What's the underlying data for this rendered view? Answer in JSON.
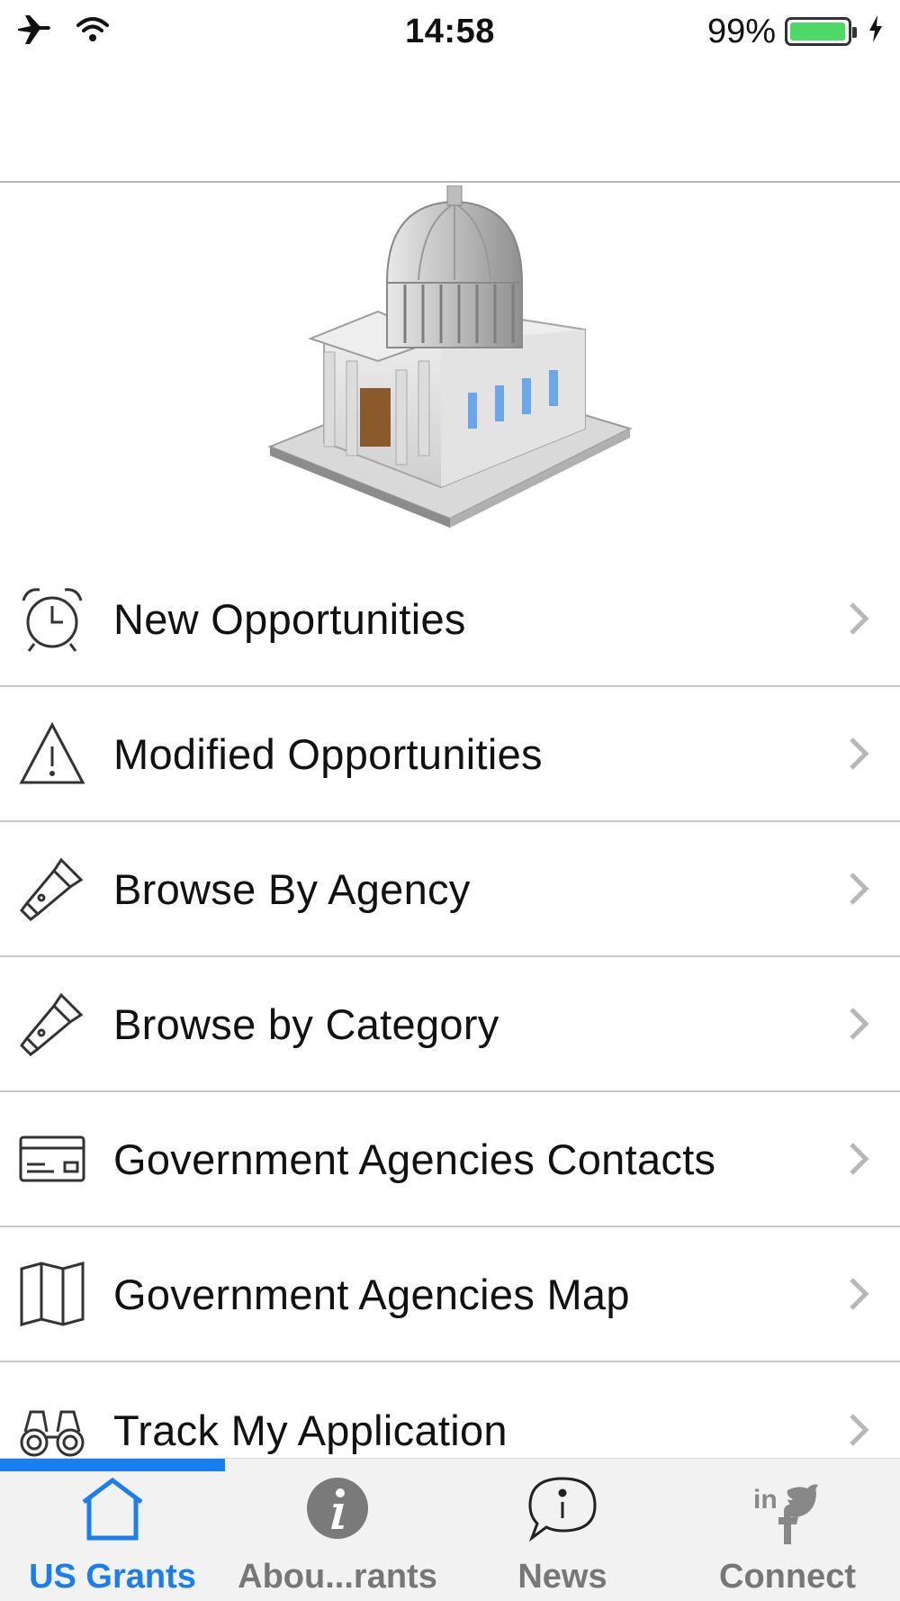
{
  "status_bar": {
    "time": "14:58",
    "battery_percent": "99%",
    "battery_level": 0.99,
    "icons": [
      "airplane-icon",
      "wifi-icon",
      "battery-icon",
      "charging-bolt-icon"
    ],
    "battery_color": "#4cd964"
  },
  "hero": {
    "icon": "government-building-icon"
  },
  "menu": {
    "items": [
      {
        "label": "New Opportunities",
        "icon": "alarm-clock-icon"
      },
      {
        "label": "Modified Opportunities",
        "icon": "warning-triangle-icon"
      },
      {
        "label": "Browse By Agency",
        "icon": "flashlight-icon"
      },
      {
        "label": "Browse by Category",
        "icon": "flashlight-icon"
      },
      {
        "label": "Government Agencies Contacts",
        "icon": "contact-card-icon"
      },
      {
        "label": "Government Agencies Map",
        "icon": "map-icon"
      },
      {
        "label": "Track My Application",
        "icon": "binoculars-icon"
      }
    ]
  },
  "tab_bar": {
    "accent_color": "#1a7df0",
    "tabs": [
      {
        "label": "US Grants",
        "icon": "home-icon",
        "active": true
      },
      {
        "label": "Abou...rants",
        "icon": "info-circle-icon",
        "active": false
      },
      {
        "label": "News",
        "icon": "speech-bubble-info-icon",
        "active": false
      },
      {
        "label": "Connect",
        "icon": "social-icon",
        "active": false
      }
    ]
  }
}
